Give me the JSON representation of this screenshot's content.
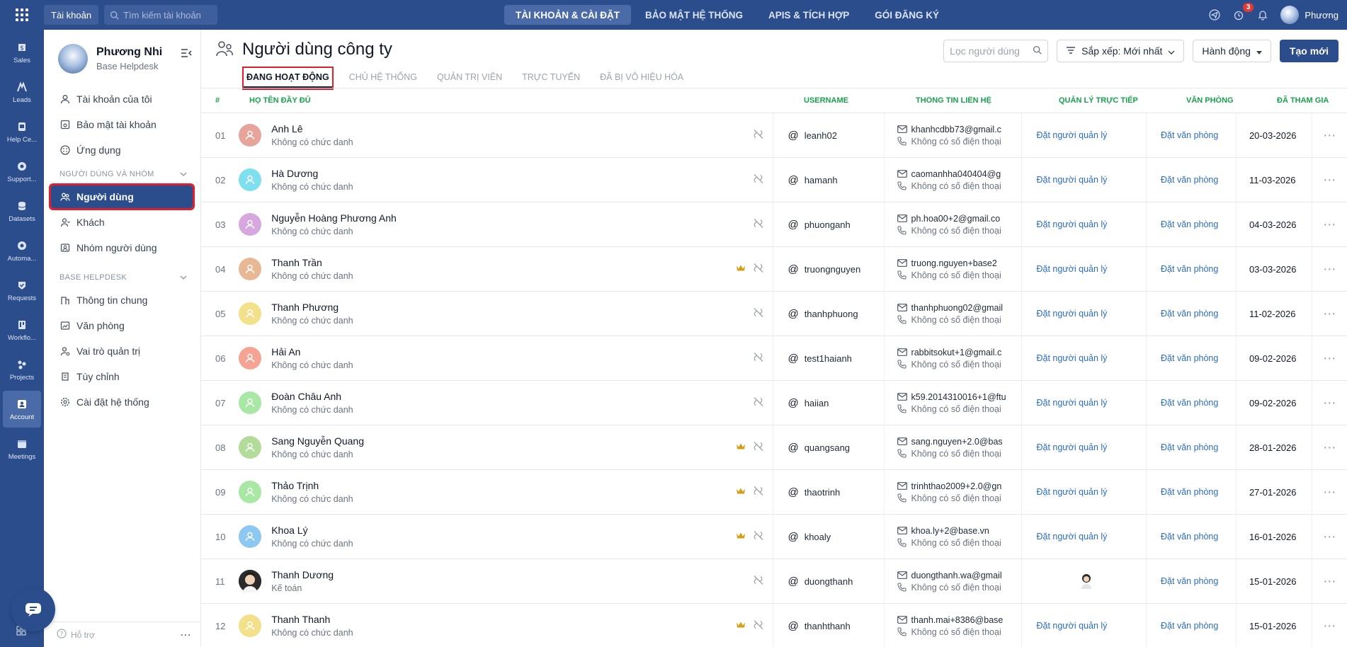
{
  "topbar": {
    "account_label": "Tài khoản",
    "search_placeholder": "Tìm kiếm tài khoản",
    "nav": [
      {
        "label": "TÀI KHOẢN & CÀI ĐẶT",
        "active": true
      },
      {
        "label": "BẢO MẬT HỆ THỐNG",
        "active": false
      },
      {
        "label": "APIS & TÍCH HỢP",
        "active": false
      },
      {
        "label": "GÓI ĐĂNG KÝ",
        "active": false
      }
    ],
    "notification_count": "3",
    "user_name": "Phương"
  },
  "rail": [
    {
      "label": "Sales",
      "icon": "sales-icon"
    },
    {
      "label": "Leads",
      "icon": "leads-icon"
    },
    {
      "label": "Help Ce...",
      "icon": "helpcenter-icon"
    },
    {
      "label": "Support...",
      "icon": "support-icon"
    },
    {
      "label": "Datasets",
      "icon": "datasets-icon"
    },
    {
      "label": "Automa...",
      "icon": "automation-icon"
    },
    {
      "label": "Requests",
      "icon": "requests-icon"
    },
    {
      "label": "Workflo...",
      "icon": "workflow-icon"
    },
    {
      "label": "Projects",
      "icon": "projects-icon"
    },
    {
      "label": "Account",
      "icon": "account-icon",
      "active": true
    },
    {
      "label": "Meetings",
      "icon": "meetings-icon"
    }
  ],
  "profile": {
    "name": "Phương Nhi",
    "org": "Base Helpdesk"
  },
  "menu_top": [
    {
      "label": "Tài khoản của tôi",
      "icon": "user-icon"
    },
    {
      "label": "Bảo mật tài khoản",
      "icon": "security-icon"
    },
    {
      "label": "Ứng dụng",
      "icon": "apps-icon"
    }
  ],
  "section_users": {
    "title": "NGƯỜI DÙNG VÀ NHÓM",
    "items": [
      {
        "label": "Người dùng",
        "icon": "users-icon",
        "active": true
      },
      {
        "label": "Khách",
        "icon": "guest-icon"
      },
      {
        "label": "Nhóm người dùng",
        "icon": "group-icon"
      }
    ]
  },
  "section_helpdesk": {
    "title": "BASE HELPDESK",
    "items": [
      {
        "label": "Thông tin chung",
        "icon": "info-icon"
      },
      {
        "label": "Văn phòng",
        "icon": "office-icon"
      },
      {
        "label": "Vai trò quản trị",
        "icon": "admin-role-icon"
      },
      {
        "label": "Tùy chỉnh",
        "icon": "customize-icon"
      },
      {
        "label": "Cài đặt hệ thống",
        "icon": "settings-icon"
      }
    ]
  },
  "help_label": "Hỗ trợ",
  "page": {
    "title": "Người dùng công ty",
    "tabs": [
      "ĐANG HOẠT ĐỘNG",
      "CHỦ HỆ THỐNG",
      "QUẢN TRỊ VIÊN",
      "TRỰC TUYẾN",
      "ĐÃ BỊ VÔ HIỆU HÓA"
    ],
    "filter_placeholder": "Lọc người dùng",
    "sort_label": "Sắp xếp: Mới nhất",
    "action_label": "Hành động",
    "create_label": "Tạo mới"
  },
  "table": {
    "headers": {
      "num": "#",
      "name": "HỌ TÊN ĐẦY ĐỦ",
      "username": "USERNAME",
      "contact": "THÔNG TIN LIÊN HỆ",
      "manager": "QUẢN LÝ TRỰC TIẾP",
      "office": "VĂN PHÒNG",
      "joined": "ĐÃ THAM GIA"
    },
    "rows": [
      {
        "num": "01",
        "name": "Anh Lê",
        "title": "Không có chức danh",
        "username": "leanh02",
        "email": "khanhcdbb73@gmail.c",
        "phone": "Không có số điện thoại",
        "manager": "Đặt người quản lý",
        "office": "Đặt văn phòng",
        "joined": "20-03-2026",
        "avatar_color": "#e6a49a",
        "crown": false
      },
      {
        "num": "02",
        "name": "Hà Dương",
        "title": "Không có chức danh",
        "username": "hamanh",
        "email": "caomanhha040404@g",
        "phone": "Không có số điện thoại",
        "manager": "Đặt người quản lý",
        "office": "Đặt văn phòng",
        "joined": "11-03-2026",
        "avatar_color": "#7ee0ee",
        "crown": false
      },
      {
        "num": "03",
        "name": "Nguyễn Hoàng Phương Anh",
        "title": "Không có chức danh",
        "username": "phuonganh",
        "email": "ph.hoa00+2@gmail.co",
        "phone": "Không có số điện thoại",
        "manager": "Đặt người quản lý",
        "office": "Đặt văn phòng",
        "joined": "04-03-2026",
        "avatar_color": "#d7a8e0",
        "crown": false
      },
      {
        "num": "04",
        "name": "Thanh Trần",
        "title": "Không có chức danh",
        "username": "truongnguyen",
        "email": "truong.nguyen+base2",
        "phone": "Không có số điện thoại",
        "manager": "Đặt người quản lý",
        "office": "Đặt văn phòng",
        "joined": "03-03-2026",
        "avatar_color": "#e8b894",
        "crown": true
      },
      {
        "num": "05",
        "name": "Thanh Phương",
        "title": "Không có chức danh",
        "username": "thanhphuong",
        "email": "thanhphuong02@gmail",
        "phone": "Không có số điện thoại",
        "manager": "Đặt người quản lý",
        "office": "Đặt văn phòng",
        "joined": "11-02-2026",
        "avatar_color": "#f3e08a",
        "crown": false
      },
      {
        "num": "06",
        "name": "Hải An",
        "title": "Không có chức danh",
        "username": "test1haianh",
        "email": "rabbitsokut+1@gmail.c",
        "phone": "Không có số điện thoại",
        "manager": "Đặt người quản lý",
        "office": "Đặt văn phòng",
        "joined": "09-02-2026",
        "avatar_color": "#f5a494",
        "crown": false
      },
      {
        "num": "07",
        "name": "Đoàn Châu Anh",
        "title": "Không có chức danh",
        "username": "haiian",
        "email": "k59.2014310016+1@ftu",
        "phone": "Không có số điện thoại",
        "manager": "Đặt người quản lý",
        "office": "Đặt văn phòng",
        "joined": "09-02-2026",
        "avatar_color": "#a8e8a4",
        "crown": false
      },
      {
        "num": "08",
        "name": "Sang Nguyễn Quang",
        "title": "Không có chức danh",
        "username": "quangsang",
        "email": "sang.nguyen+2.0@bas",
        "phone": "Không có số điện thoại",
        "manager": "Đặt người quản lý",
        "office": "Đặt văn phòng",
        "joined": "28-01-2026",
        "avatar_color": "#b3dc9a",
        "crown": true
      },
      {
        "num": "09",
        "name": "Thảo Trịnh",
        "title": "Không có chức danh",
        "username": "thaotrinh",
        "email": "trinhthao2009+2.0@gn",
        "phone": "Không có số điện thoại",
        "manager": "Đặt người quản lý",
        "office": "Đặt văn phòng",
        "joined": "27-01-2026",
        "avatar_color": "#a8e8a4",
        "crown": true
      },
      {
        "num": "10",
        "name": "Khoa Lý",
        "title": "Không có chức danh",
        "username": "khoaly",
        "email": "khoa.ly+2@base.vn",
        "phone": "Không có số điện thoại",
        "manager": "Đặt người quản lý",
        "office": "Đặt văn phòng",
        "joined": "16-01-2026",
        "avatar_color": "#8cc8f0",
        "crown": true
      },
      {
        "num": "11",
        "name": "Thanh Dương",
        "title": "Kế toán",
        "username": "duongthanh",
        "email": "duongthanh.wa@gmail",
        "phone": "Không có số điện thoại",
        "manager": "",
        "office": "Đặt văn phòng",
        "joined": "15-01-2026",
        "avatar_color": "#2b2b2b",
        "crown": false,
        "photo": true
      },
      {
        "num": "12",
        "name": "Thanh Thanh",
        "title": "Không có chức danh",
        "username": "thanhthanh",
        "email": "thanh.mai+8386@base",
        "phone": "Không có số điện thoại",
        "manager": "Đặt người quản lý",
        "office": "Đặt văn phòng",
        "joined": "15-01-2026",
        "avatar_color": "#f3e08a",
        "crown": true
      }
    ]
  },
  "colors": {
    "brand": "#2c4d8c",
    "link": "#2c6dc9",
    "header_green": "#16a34a",
    "highlight_red": "#e11d2e",
    "crown": "#d4a017"
  }
}
